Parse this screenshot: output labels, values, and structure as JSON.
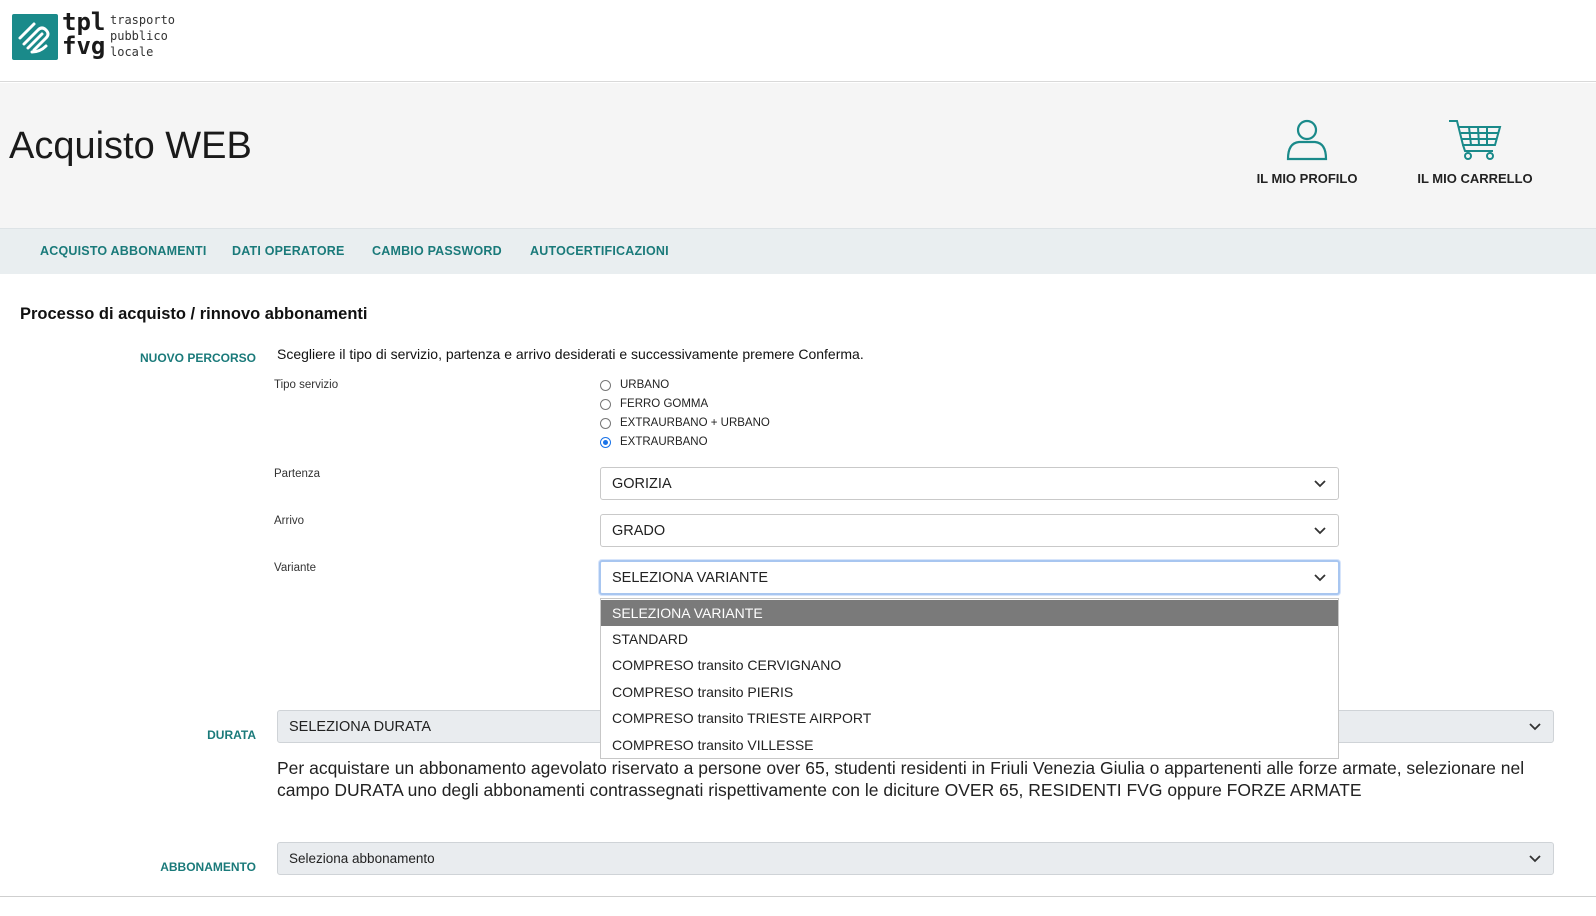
{
  "logo": {
    "tpl": "tpl",
    "fvg": "fvg",
    "sub_line1": "trasporto",
    "sub_line2": "pubblico",
    "sub_line3": "locale"
  },
  "header": {
    "title": "Acquisto WEB",
    "profile_label": "IL MIO PROFILO",
    "cart_label": "IL MIO CARRELLO"
  },
  "nav": {
    "items": [
      "ACQUISTO ABBONAMENTI",
      "DATI OPERATORE",
      "CAMBIO PASSWORD",
      "AUTOCERTIFICAZIONI"
    ]
  },
  "main": {
    "section_title": "Processo di acquisto / rinnovo abbonamenti",
    "nuovo_percorso_label": "NUOVO PERCORSO",
    "instructions": "Scegliere il tipo di servizio, partenza e arrivo desiderati e successivamente premere Conferma.",
    "tipo_servizio": {
      "label": "Tipo servizio",
      "options": [
        "URBANO",
        "FERRO GOMMA",
        "EXTRAURBANO + URBANO",
        "EXTRAURBANO"
      ],
      "selected": "EXTRAURBANO"
    },
    "partenza": {
      "label": "Partenza",
      "value": "GORIZIA"
    },
    "arrivo": {
      "label": "Arrivo",
      "value": "GRADO"
    },
    "variante": {
      "label": "Variante",
      "value": "SELEZIONA VARIANTE",
      "options": [
        "SELEZIONA VARIANTE",
        "STANDARD",
        "COMPRESO transito CERVIGNANO",
        "COMPRESO transito PIERIS",
        "COMPRESO transito TRIESTE AIRPORT",
        "COMPRESO transito VILLESSE"
      ]
    },
    "durata": {
      "label": "DURATA",
      "value": "SELEZIONA DURATA"
    },
    "note": "Per acquistare un abbonamento agevolato riservato a persone over 65, studenti residenti in Friuli Venezia Giulia o appartenenti alle forze armate, selezionare nel campo DURATA uno degli abbonamenti contrassegnati rispettivamente con le diciture OVER 65, RESIDENTI FVG oppure FORZE ARMATE",
    "abbonamento": {
      "label": "ABBONAMENTO",
      "value": "Seleziona abbonamento"
    }
  },
  "colors": {
    "accent": "#1a7a7a",
    "logo": "#1a8a8a",
    "dropdown_selected": "#7a7a7a"
  }
}
